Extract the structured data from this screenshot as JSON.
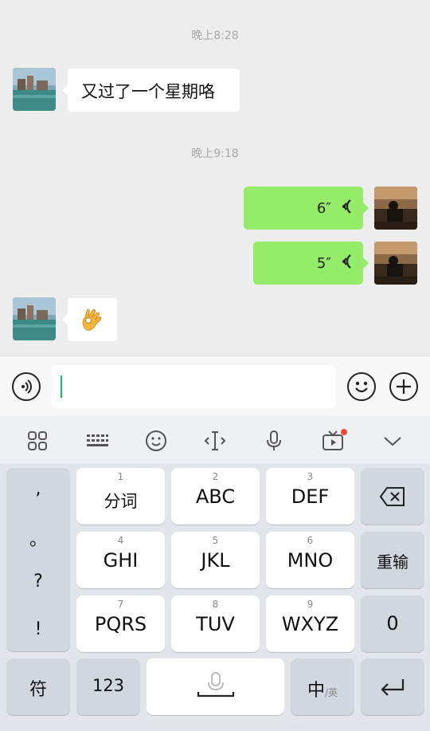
{
  "chat": {
    "time1": "晚上8:28",
    "msg1": "又过了一个星期咯",
    "time2": "晚上9:18",
    "voice1": "6″",
    "voice2": "5″",
    "msg3_icon": "ok-hand-emoji"
  },
  "input": {
    "voice_icon": "voice-input-icon",
    "emoji_icon": "emoji-icon",
    "plus_icon": "plus-icon"
  },
  "toolbar": {
    "icons": [
      "apps-grid-icon",
      "keyboard-icon",
      "emoji-icon",
      "text-cursor-icon",
      "microphone-icon",
      "tv-icon",
      "chevron-down-icon"
    ]
  },
  "keyboard": {
    "punct": [
      ",",
      "。",
      "?",
      "!"
    ],
    "keys": [
      {
        "num": "1",
        "label": "分词"
      },
      {
        "num": "2",
        "label": "ABC"
      },
      {
        "num": "3",
        "label": "DEF"
      },
      {
        "num": "4",
        "label": "GHI"
      },
      {
        "num": "5",
        "label": "JKL"
      },
      {
        "num": "6",
        "label": "MNO"
      },
      {
        "num": "7",
        "label": "PQRS"
      },
      {
        "num": "8",
        "label": "TUV"
      },
      {
        "num": "9",
        "label": "WXYZ"
      }
    ],
    "reenter": "重输",
    "zero": "0",
    "symbol": "符",
    "numbers": "123",
    "lang_main": "中",
    "lang_sub": "/英"
  },
  "colors": {
    "sent_bubble": "#95ec69",
    "cursor": "#07c160",
    "badge": "#f24b3a"
  }
}
